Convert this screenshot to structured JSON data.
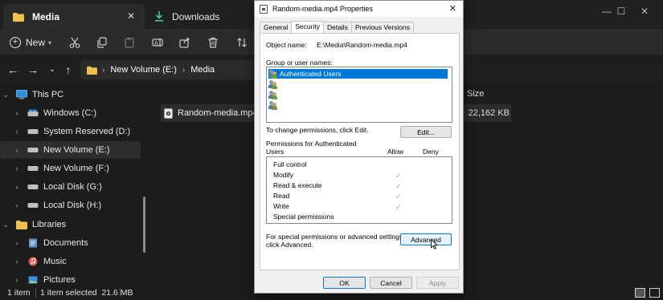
{
  "explorer": {
    "tabs": [
      {
        "label": "Media",
        "icon": "folder-icon",
        "active": true
      },
      {
        "label": "Downloads",
        "icon": "download-icon",
        "active": false
      }
    ],
    "toolbar": {
      "new_label": "New"
    },
    "breadcrumb": [
      "New Volume (E:)",
      "Media"
    ],
    "sidebar": [
      {
        "label": "This PC",
        "icon": "computer-icon",
        "indent": 0,
        "expanded": true
      },
      {
        "label": "Windows (C:)",
        "icon": "drive-icon",
        "indent": 1
      },
      {
        "label": "System Reserved (D:)",
        "icon": "drive-icon",
        "indent": 1
      },
      {
        "label": "New Volume (E:)",
        "icon": "drive-icon",
        "indent": 1,
        "selected": true
      },
      {
        "label": "New Volume (F:)",
        "icon": "drive-icon",
        "indent": 1
      },
      {
        "label": "Local Disk (G:)",
        "icon": "drive-icon",
        "indent": 1
      },
      {
        "label": "Local Disk (H:)",
        "icon": "drive-icon",
        "indent": 1
      },
      {
        "label": "Libraries",
        "icon": "folder-icon",
        "indent": 0,
        "expanded": true
      },
      {
        "label": "Documents",
        "icon": "documents-icon",
        "indent": 1
      },
      {
        "label": "Music",
        "icon": "music-icon",
        "indent": 1
      },
      {
        "label": "Pictures",
        "icon": "pictures-icon",
        "indent": 1
      }
    ],
    "columns": {
      "size": "Size"
    },
    "file": {
      "name": "Random-media.mp4",
      "size": "22,162 KB"
    },
    "status": {
      "count": "1 item",
      "selected": "1 item selected  21.6 MB"
    }
  },
  "dialog": {
    "title": "Random-media.mp4 Properties",
    "tabs": [
      "General",
      "Security",
      "Details",
      "Previous Versions"
    ],
    "active_tab": "Security",
    "object_name_label": "Object name:",
    "object_name_value": "E:\\Media\\Random-media.mp4",
    "group_label": "Group or user names:",
    "users": [
      "Authenticated Users",
      "",
      "",
      ""
    ],
    "change_text": "To change permissions, click Edit.",
    "edit_label": "Edit...",
    "perm_header_line1": "Permissions for Authenticated",
    "perm_header_line2": "Users",
    "allow_label": "Allow",
    "deny_label": "Deny",
    "permissions": [
      {
        "name": "Full control",
        "allow": false
      },
      {
        "name": "Modify",
        "allow": true
      },
      {
        "name": "Read & execute",
        "allow": true
      },
      {
        "name": "Read",
        "allow": true
      },
      {
        "name": "Write",
        "allow": true
      },
      {
        "name": "Special permissions",
        "allow": false
      }
    ],
    "special_text_line1": "For special permissions or advanced settings,",
    "special_text_line2": "click Advanced.",
    "advanced_label": "Advanced",
    "ok_label": "OK",
    "cancel_label": "Cancel",
    "apply_label": "Apply"
  }
}
